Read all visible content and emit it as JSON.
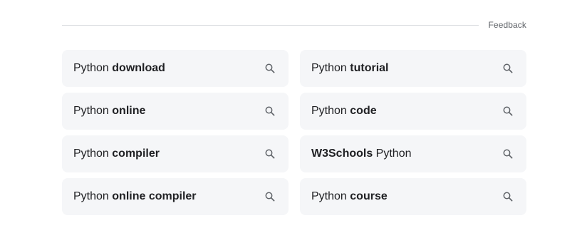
{
  "feedback": {
    "label": "Feedback"
  },
  "related_searches": [
    {
      "parts": [
        {
          "text": "Python ",
          "bold": false
        },
        {
          "text": "download",
          "bold": true
        }
      ],
      "icon": "search-icon"
    },
    {
      "parts": [
        {
          "text": "Python ",
          "bold": false
        },
        {
          "text": "tutorial",
          "bold": true
        }
      ],
      "icon": "search-icon"
    },
    {
      "parts": [
        {
          "text": "Python ",
          "bold": false
        },
        {
          "text": "online",
          "bold": true
        }
      ],
      "icon": "search-icon"
    },
    {
      "parts": [
        {
          "text": "Python ",
          "bold": false
        },
        {
          "text": "code",
          "bold": true
        }
      ],
      "icon": "search-icon"
    },
    {
      "parts": [
        {
          "text": "Python ",
          "bold": false
        },
        {
          "text": "compiler",
          "bold": true
        }
      ],
      "icon": "search-icon"
    },
    {
      "parts": [
        {
          "text": "W3Schools",
          "bold": true
        },
        {
          "text": " Python",
          "bold": false
        }
      ],
      "icon": "search-icon"
    },
    {
      "parts": [
        {
          "text": "Python ",
          "bold": false
        },
        {
          "text": "online compiler",
          "bold": true
        }
      ],
      "icon": "search-icon"
    },
    {
      "parts": [
        {
          "text": "Python ",
          "bold": false
        },
        {
          "text": "course",
          "bold": true
        }
      ],
      "icon": "search-icon"
    }
  ],
  "colors": {
    "card_background": "#f5f6f8",
    "text": "#202124",
    "muted": "#5f6368",
    "divider": "#dadce0"
  }
}
